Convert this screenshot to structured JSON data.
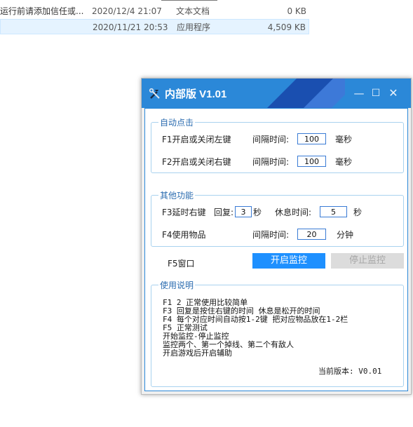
{
  "explorer": {
    "rows": [
      {
        "name": "运行前请添加信任或...",
        "date": "2020/12/4 21:07",
        "type": "文本文档",
        "size": "0 KB"
      },
      {
        "name": "",
        "date": "2020/11/21 20:53",
        "type": "应用程序",
        "size": "4,509 KB"
      }
    ]
  },
  "dialog": {
    "title": "内部版 V1.01",
    "icons": [
      "tools-icon",
      "minimize-icon",
      "maximize-icon",
      "close-icon"
    ],
    "auto_click": {
      "title": "自动点击",
      "row1": {
        "label": "F1开启或关闭左键",
        "interval_label": "间隔时间:",
        "value": "100",
        "unit": "毫秒"
      },
      "row2": {
        "label": "F2开启或关闭右键",
        "interval_label": "间隔时间:",
        "value": "100",
        "unit": "毫秒"
      }
    },
    "other": {
      "title": "其他功能",
      "row1": {
        "label": "F3延时右键",
        "reply_label": "回复:",
        "reply_value": "3",
        "reply_unit": "秒",
        "rest_label": "休息时间:",
        "rest_value": "5",
        "rest_unit": "秒"
      },
      "row2": {
        "label": "F4使用物品",
        "interval_label": "间隔时间:",
        "value": "20",
        "unit": "分钟"
      }
    },
    "window_label": "F5窗口",
    "start_button": "开启监控",
    "stop_button": "停止监控",
    "usage": {
      "title": "使用说明",
      "lines": [
        "F1 2 正常使用比较简单",
        "F3 回复是按住右键的时间  休息是松开的时间",
        "F4 每个对应时间自动按1-2键 把对应物品放在1-2栏",
        "F5 正常测试",
        "开始监控-停止监控",
        "监控两个、第一个掉线、第二个有敌人",
        "开启游戏后开启辅助"
      ],
      "version": "当前版本: V0.01"
    },
    "colors": {
      "titlebar": "#2b88d8",
      "accent": "#1e90ff"
    }
  }
}
